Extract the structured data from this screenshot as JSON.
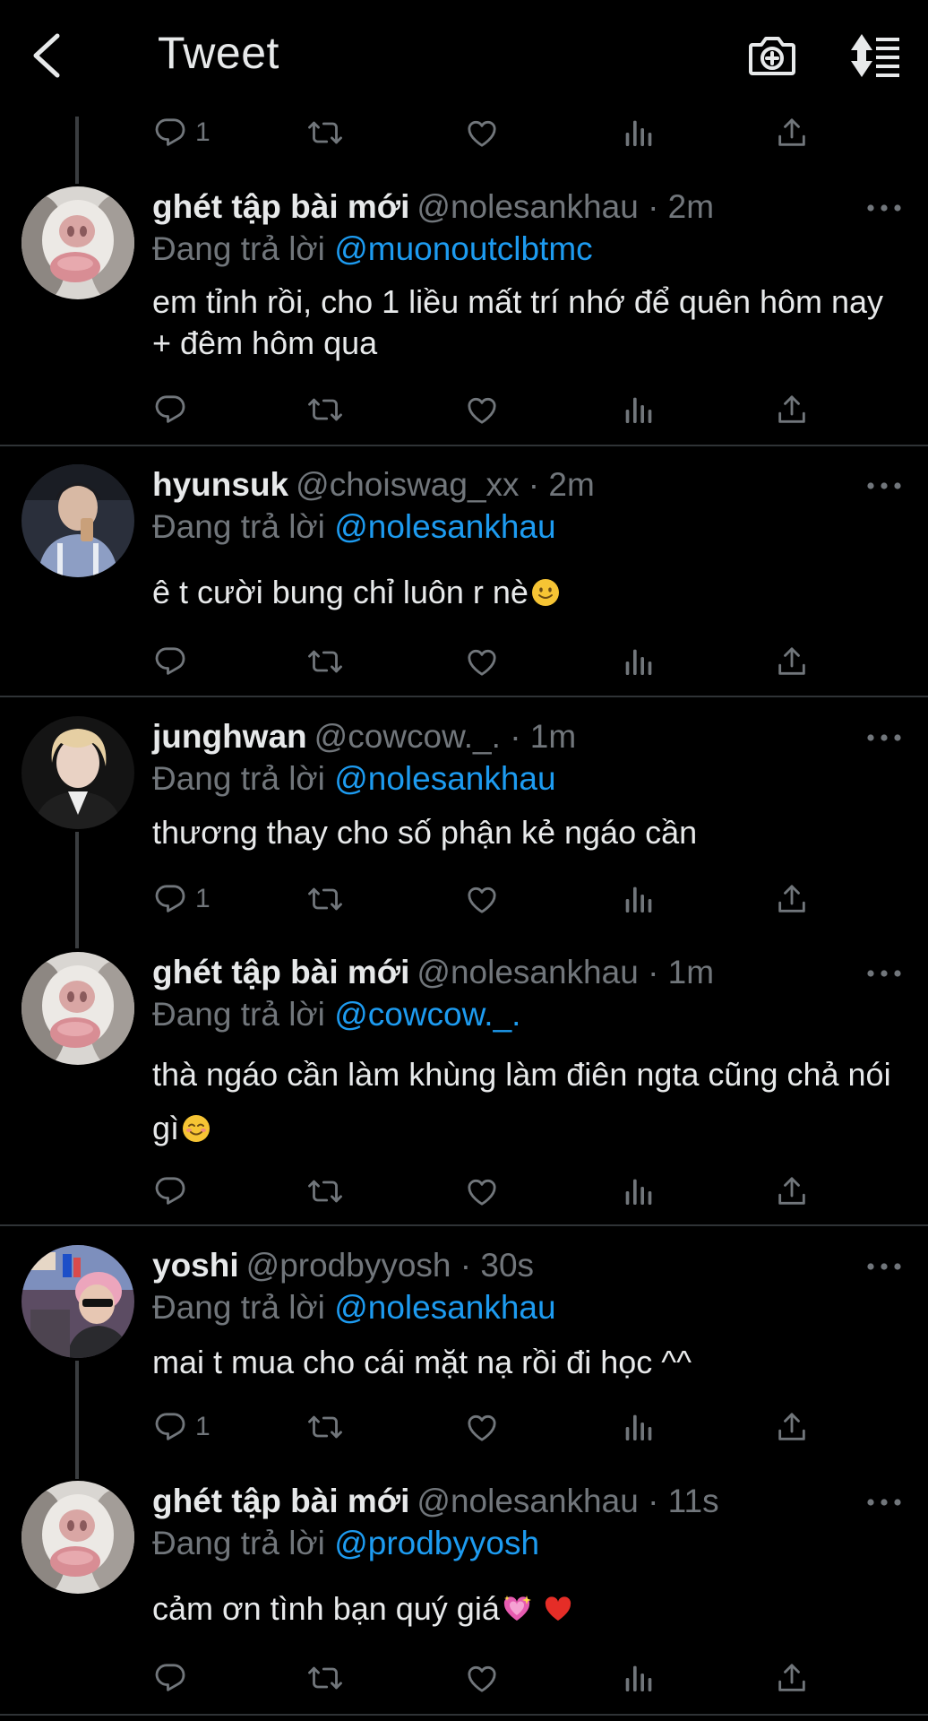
{
  "header": {
    "title": "Tweet",
    "back_icon": "chevron-left-icon",
    "camera_icon": "camera-plus-icon",
    "sort_icon": "sort-icon"
  },
  "top_actions": {
    "reply_count": "1"
  },
  "tweets": [
    {
      "display_name": "ghét tập bài mới",
      "handle": "@nolesankhau · 2m",
      "reply_prefix": "Đang trả lời",
      "reply_to": "@muonoutclbtmc",
      "body": "em tỉnh rồi, cho 1 liều mất trí nhớ để quên hôm nay + đêm hôm qua",
      "reply_count": ""
    },
    {
      "display_name": "hyunsuk",
      "handle": "@choiswag_xx · 2m",
      "reply_prefix": "Đang trả lời",
      "reply_to": "@nolesankhau",
      "body": "ê t cười bung chỉ luôn r nè",
      "emoji": "slightly-smiling-face",
      "reply_count": ""
    },
    {
      "display_name": "junghwan",
      "handle": "@cowcow._. · 1m",
      "reply_prefix": "Đang trả lời",
      "reply_to": "@nolesankhau",
      "body": "thương thay cho số phận kẻ ngáo cần",
      "reply_count": "1"
    },
    {
      "display_name": "ghét tập bài mới",
      "handle": "@nolesankhau · 1m",
      "reply_prefix": "Đang trả lời",
      "reply_to": "@cowcow._.",
      "body": "thà ngáo cần làm khùng làm điên ngta cũng chả nói gì",
      "emoji": "smiling-face",
      "reply_count": ""
    },
    {
      "display_name": "yoshi",
      "handle": "@prodbyyosh · 30s",
      "reply_prefix": "Đang trả lời",
      "reply_to": "@nolesankhau",
      "body": "mai t mua cho cái mặt nạ rồi đi học ^^",
      "reply_count": "1"
    },
    {
      "display_name": "ghét tập bài mới",
      "handle": "@nolesankhau · 11s",
      "reply_prefix": "Đang trả lời",
      "reply_to": "@prodbyyosh",
      "body": "cảm ơn tình bạn quý giá",
      "emoji": "sparkling-heart red-heart",
      "reply_count": ""
    }
  ],
  "colors": {
    "background": "#000000",
    "text": "#e7e9ea",
    "secondary": "#71767b",
    "link": "#1d9bf0",
    "divider": "#2f3336"
  }
}
